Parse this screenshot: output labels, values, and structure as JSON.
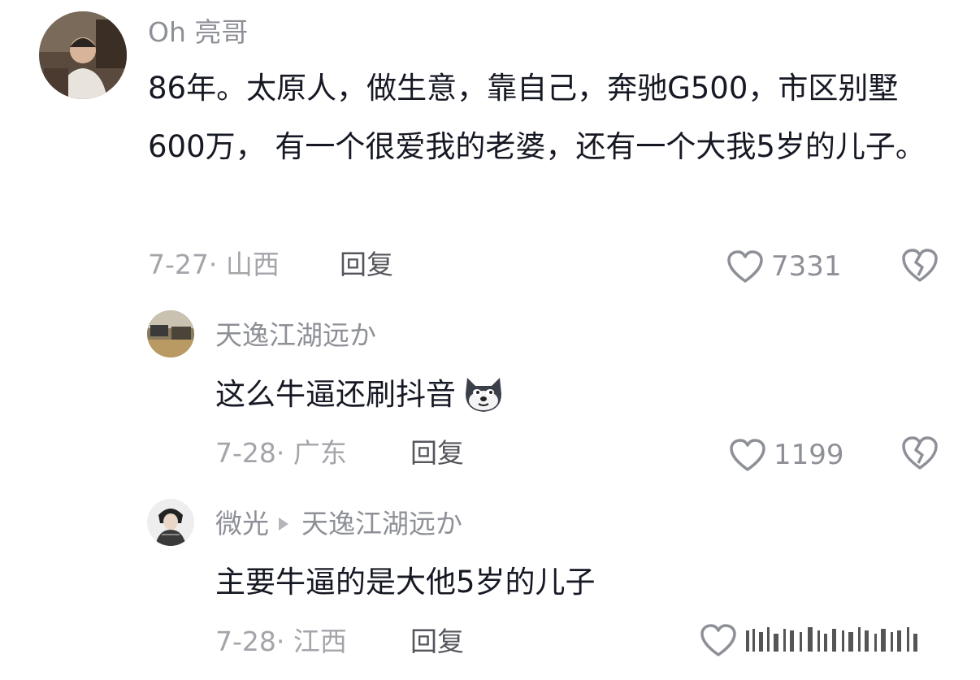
{
  "comments": [
    {
      "username": "Oh 亮哥",
      "content": "86年。太原人，做生意，靠自己，奔驰G500，市区别墅600万， 有一个很爱我的老婆，还有一个大我5岁的儿子。",
      "date_location": "7-27· 山西",
      "reply_label": "回复",
      "likes": "7331"
    },
    {
      "username": "天逸江湖远か",
      "content": "这么牛逼还刷抖音",
      "emoji": "doge-emoji",
      "date_location": "7-28· 广东",
      "reply_label": "回复",
      "likes": "1199"
    },
    {
      "username": "微光",
      "reply_to": "天逸江湖远か",
      "content": "主要牛逼的是大他5岁的儿子",
      "date_location": "7-28· 江西",
      "reply_label": "回复"
    }
  ],
  "icons": {
    "like": "heart-outline-icon",
    "dislike": "broken-heart-icon"
  },
  "colors": {
    "text_primary": "#161823",
    "text_secondary": "#8e9097",
    "meta": "#a4a5aa"
  }
}
